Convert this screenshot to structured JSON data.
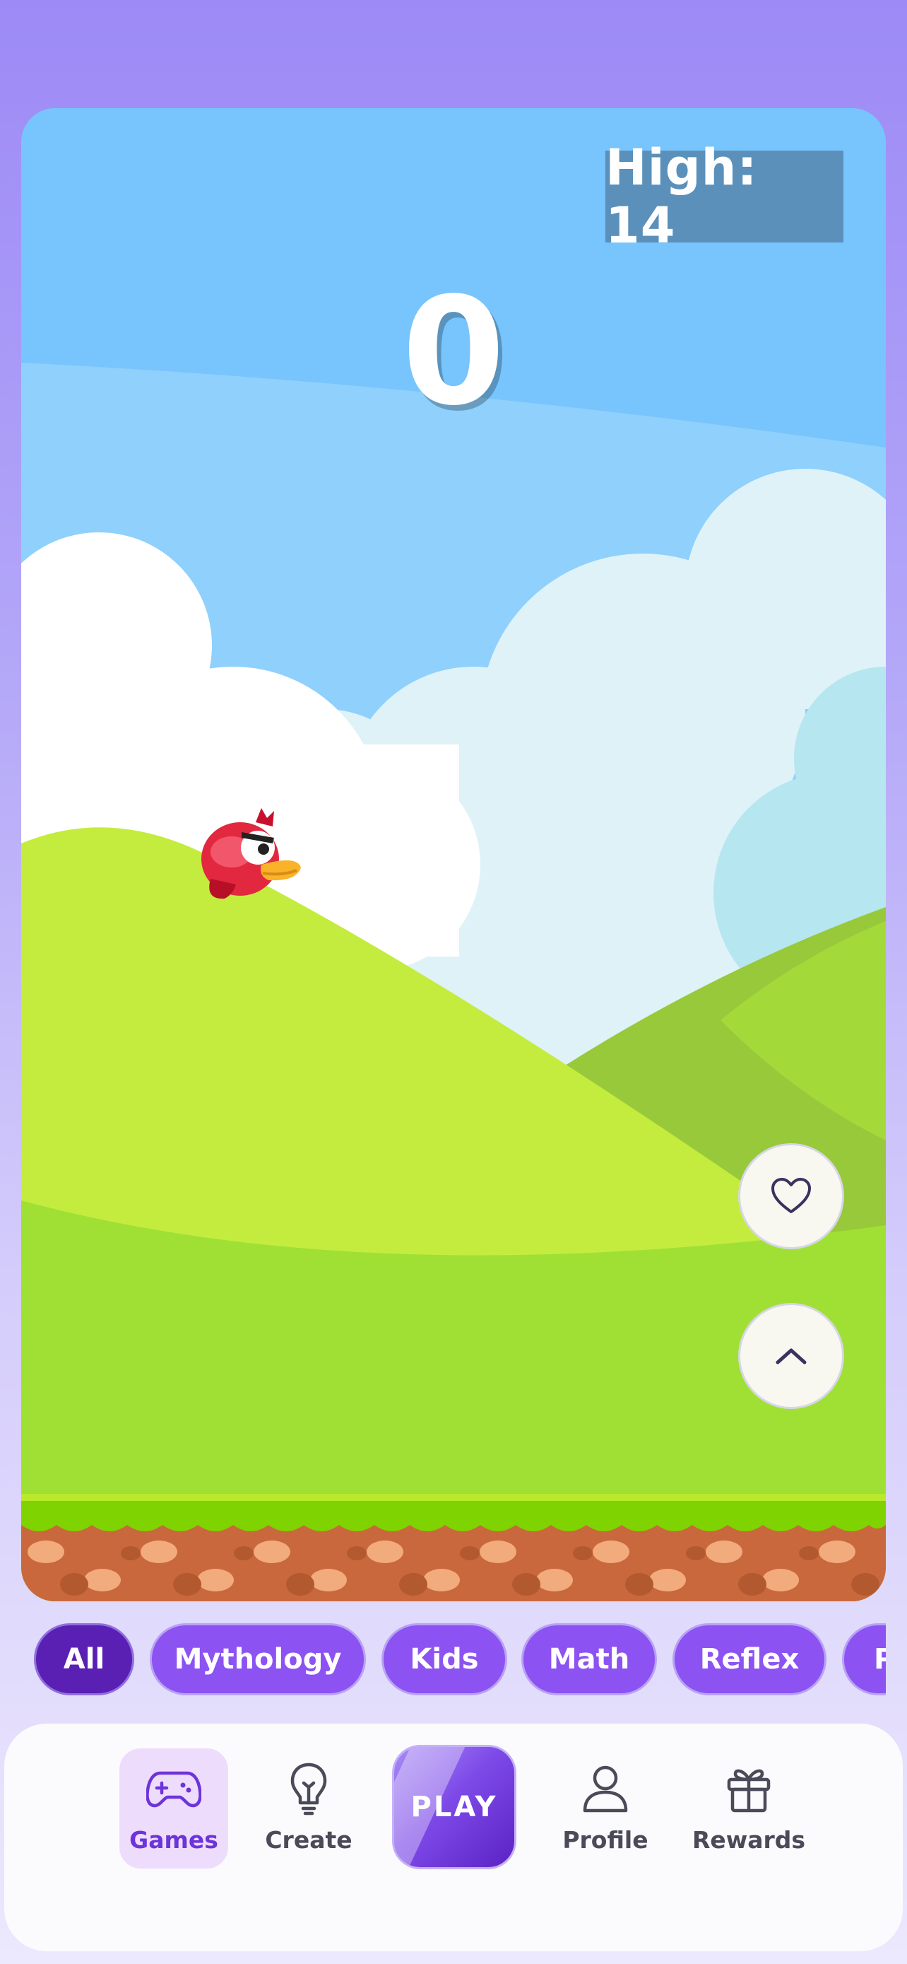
{
  "game": {
    "high_label": "High: 14",
    "score": "0"
  },
  "actions": {
    "like_icon": "heart-icon",
    "up_icon": "chevron-up-icon"
  },
  "categories": [
    "All",
    "Mythology",
    "Kids",
    "Math",
    "Reflex",
    "P"
  ],
  "nav": {
    "games": "Games",
    "create": "Create",
    "play": "PLAY",
    "profile": "Profile",
    "rewards": "Rewards"
  },
  "colors": {
    "accent": "#8c52f2",
    "active_chip": "#5a1fb3",
    "sky": "#78c4fd"
  }
}
